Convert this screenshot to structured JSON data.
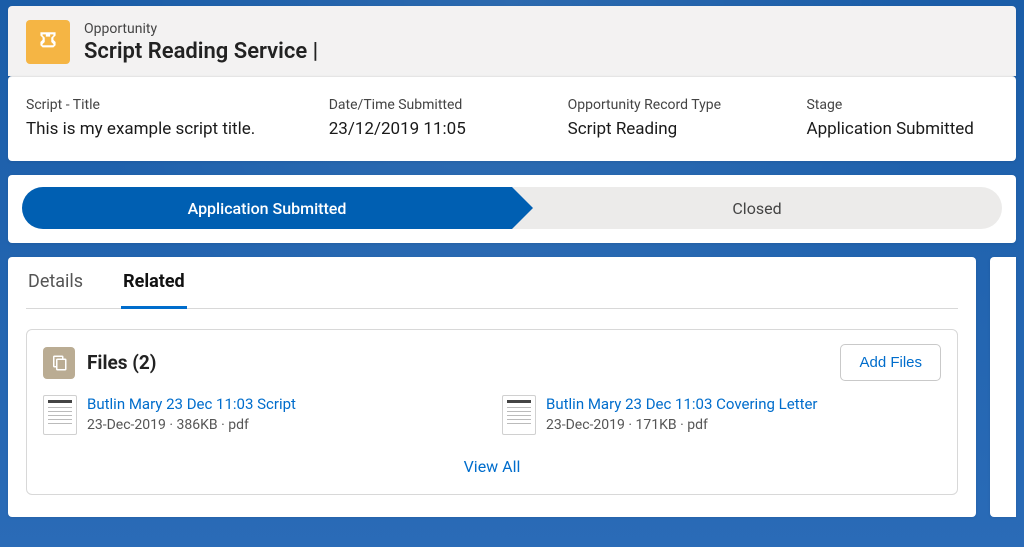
{
  "header": {
    "object_label": "Opportunity",
    "record_title": "Script Reading Service |"
  },
  "fields": [
    {
      "label": "Script - Title",
      "value": "This is my example script title."
    },
    {
      "label": "Date/Time Submitted",
      "value": "23/12/2019 11:05"
    },
    {
      "label": "Opportunity Record Type",
      "value": "Script Reading"
    },
    {
      "label": "Stage",
      "value": "Application Submitted"
    }
  ],
  "path": {
    "stages": [
      {
        "label": "Application Submitted",
        "current": true
      },
      {
        "label": "Closed",
        "current": false
      }
    ]
  },
  "tabs": [
    {
      "label": "Details",
      "active": false
    },
    {
      "label": "Related",
      "active": true
    }
  ],
  "files_card": {
    "title": "Files (2)",
    "add_button": "Add Files",
    "view_all": "View All",
    "files": [
      {
        "name": "Butlin Mary 23 Dec 11:03 Script",
        "sub": "23-Dec-2019 · 386KB · pdf"
      },
      {
        "name": "Butlin Mary 23 Dec 11:03 Covering Letter",
        "sub": "23-Dec-2019 · 171KB · pdf"
      }
    ]
  }
}
